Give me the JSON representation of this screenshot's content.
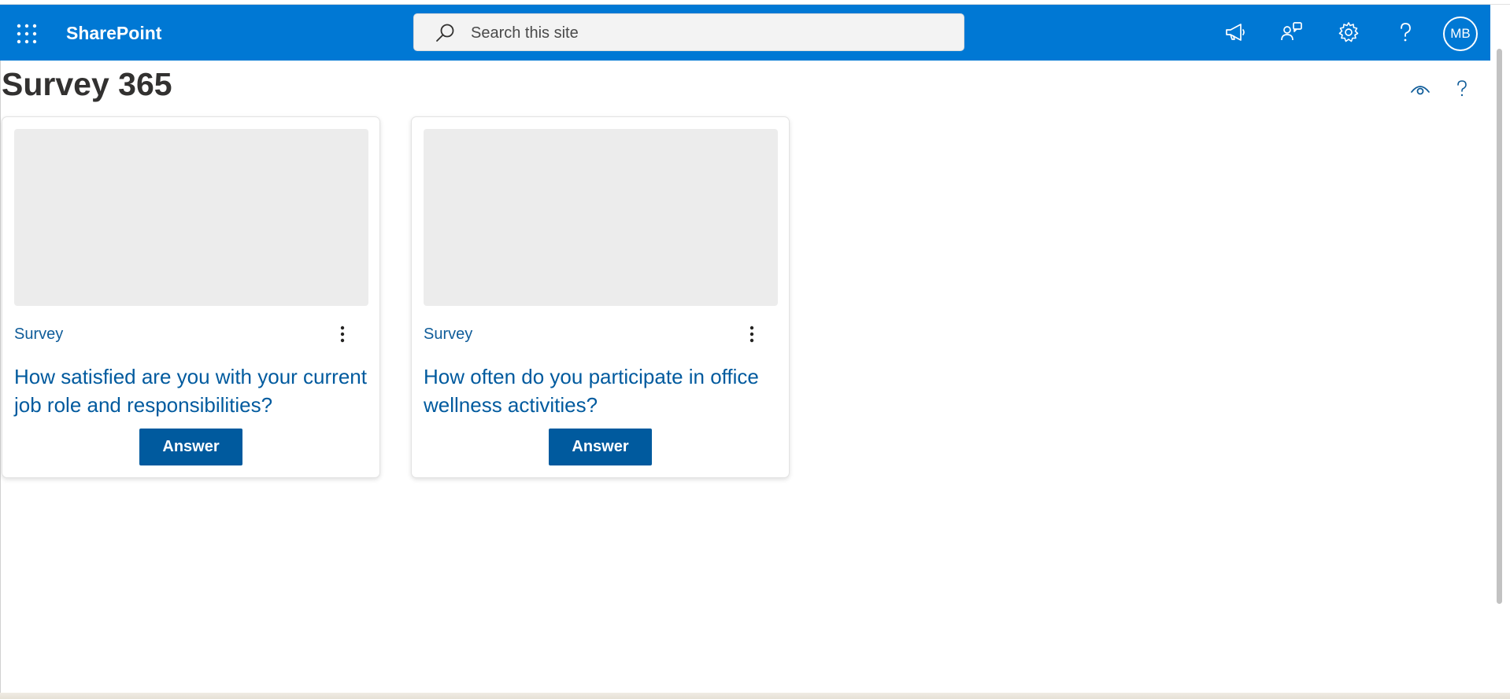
{
  "suite_bar": {
    "app_launcher_icon": "waffle-icon",
    "brand": "SharePoint",
    "search_placeholder": "Search this site",
    "icons": [
      "megaphone-icon",
      "share-people-icon",
      "gear-icon",
      "help-icon"
    ],
    "avatar_initials": "MB",
    "background": "#0078d4"
  },
  "page": {
    "title": "Survey 365",
    "tool_icons": [
      "eye-icon",
      "help-icon"
    ]
  },
  "cards": [
    {
      "category": "Survey",
      "question": "How satisfied are you with your current job role and responsibilities?",
      "button": "Answer"
    },
    {
      "category": "Survey",
      "question": "How often do you participate in office wellness activities?",
      "button": "Answer"
    }
  ],
  "colors": {
    "accent": "#0078d4",
    "link": "#005a9e",
    "button": "#005a9e"
  }
}
